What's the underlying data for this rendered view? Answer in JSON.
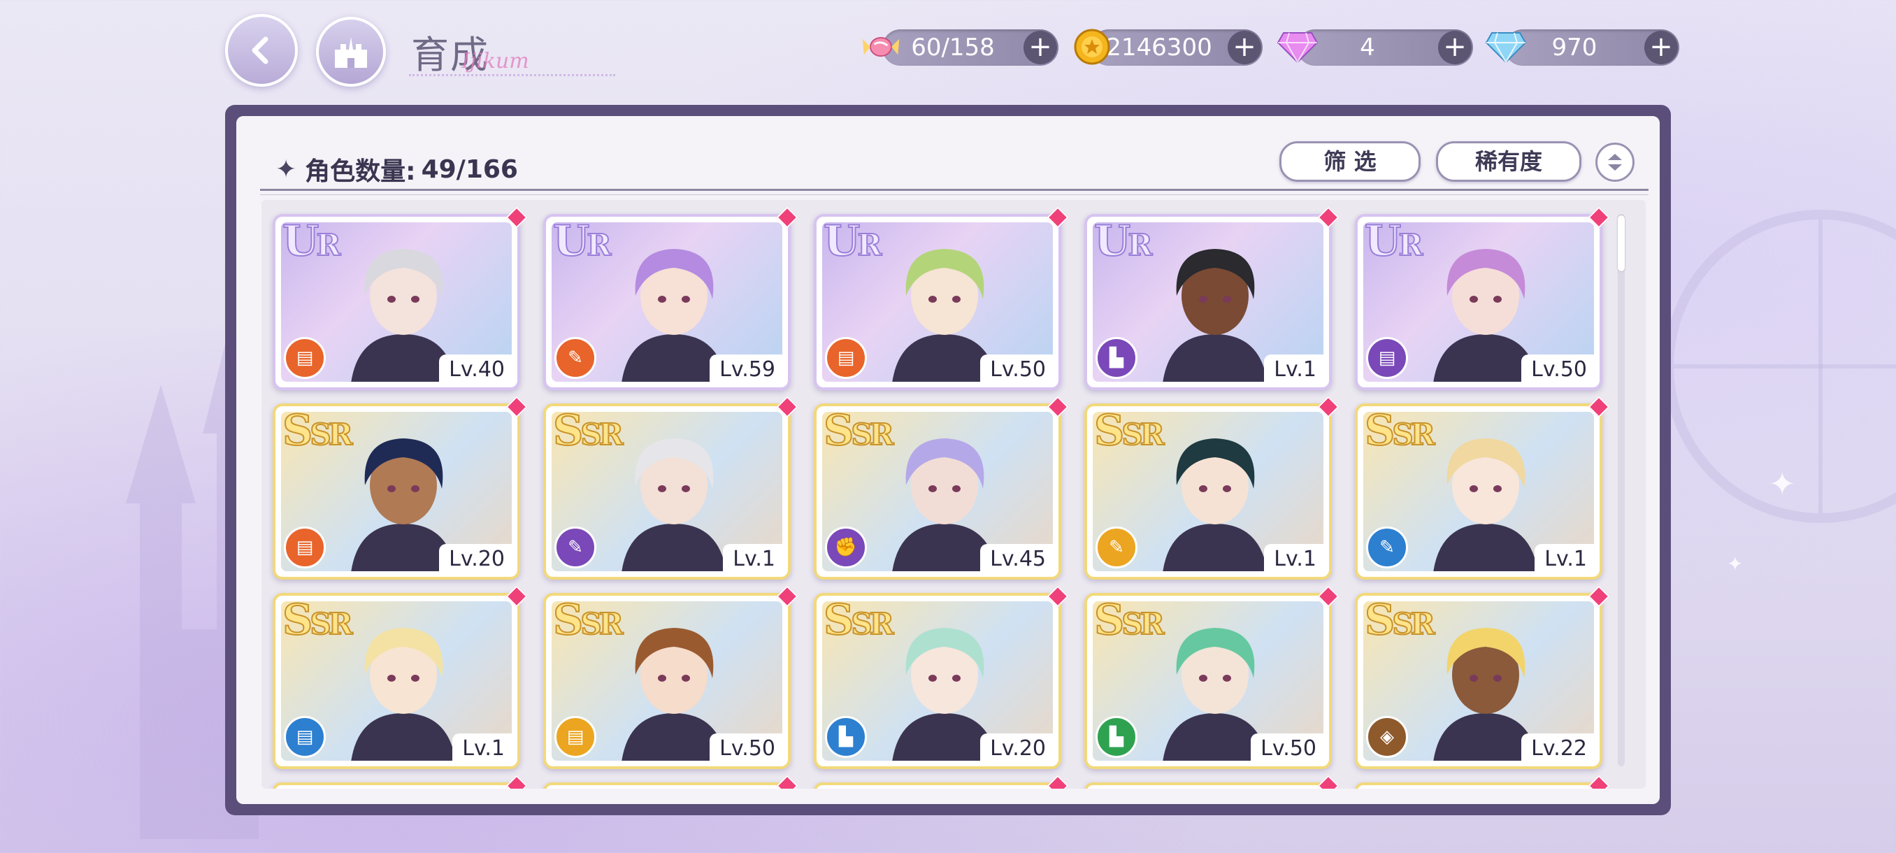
{
  "header": {
    "title": "育成",
    "title_script": "Ijikum"
  },
  "resources": [
    {
      "icon": "candy-icon",
      "value": "60/158"
    },
    {
      "icon": "gold-coin-icon",
      "value": "2146300"
    },
    {
      "icon": "pink-gem-icon",
      "value": "4"
    },
    {
      "icon": "diamond-icon",
      "value": "970"
    }
  ],
  "panel": {
    "count_label": "角色数量:",
    "count_value": "49/166",
    "filter_label": "筛 选",
    "sort_label": "稀有度"
  },
  "colors": {
    "panel_border": "#5c4e7a",
    "attr_orange": "#e8642a",
    "attr_purple": "#7a48b8",
    "attr_yellow": "#eba520",
    "attr_blue": "#2d7fd0",
    "attr_green": "#2fa250",
    "attr_brown": "#8e5a2c"
  },
  "cards": [
    {
      "rarity": "UR",
      "level": "Lv.40",
      "attr": "orange",
      "attr_icon": "book-icon"
    },
    {
      "rarity": "UR",
      "level": "Lv.59",
      "attr": "orange",
      "attr_icon": "brush-icon"
    },
    {
      "rarity": "UR",
      "level": "Lv.50",
      "attr": "orange",
      "attr_icon": "book-icon"
    },
    {
      "rarity": "UR",
      "level": "Lv.1",
      "attr": "purple",
      "attr_icon": "boot-icon"
    },
    {
      "rarity": "UR",
      "level": "Lv.50",
      "attr": "purple",
      "attr_icon": "book-icon"
    },
    {
      "rarity": "SSR",
      "level": "Lv.20",
      "attr": "orange",
      "attr_icon": "book-icon"
    },
    {
      "rarity": "SSR",
      "level": "Lv.1",
      "attr": "purple",
      "attr_icon": "brush-icon"
    },
    {
      "rarity": "SSR",
      "level": "Lv.45",
      "attr": "purple",
      "attr_icon": "fist-icon"
    },
    {
      "rarity": "SSR",
      "level": "Lv.1",
      "attr": "yellow",
      "attr_icon": "brush-icon"
    },
    {
      "rarity": "SSR",
      "level": "Lv.1",
      "attr": "blue",
      "attr_icon": "brush-icon"
    },
    {
      "rarity": "SSR",
      "level": "Lv.1",
      "attr": "blue",
      "attr_icon": "book-icon"
    },
    {
      "rarity": "SSR",
      "level": "Lv.50",
      "attr": "yellow",
      "attr_icon": "book-icon"
    },
    {
      "rarity": "SSR",
      "level": "Lv.20",
      "attr": "blue",
      "attr_icon": "boot-icon"
    },
    {
      "rarity": "SSR",
      "level": "Lv.50",
      "attr": "green",
      "attr_icon": "boot-icon"
    },
    {
      "rarity": "SSR",
      "level": "Lv.22",
      "attr": "brown",
      "attr_icon": "shield-icon"
    }
  ]
}
